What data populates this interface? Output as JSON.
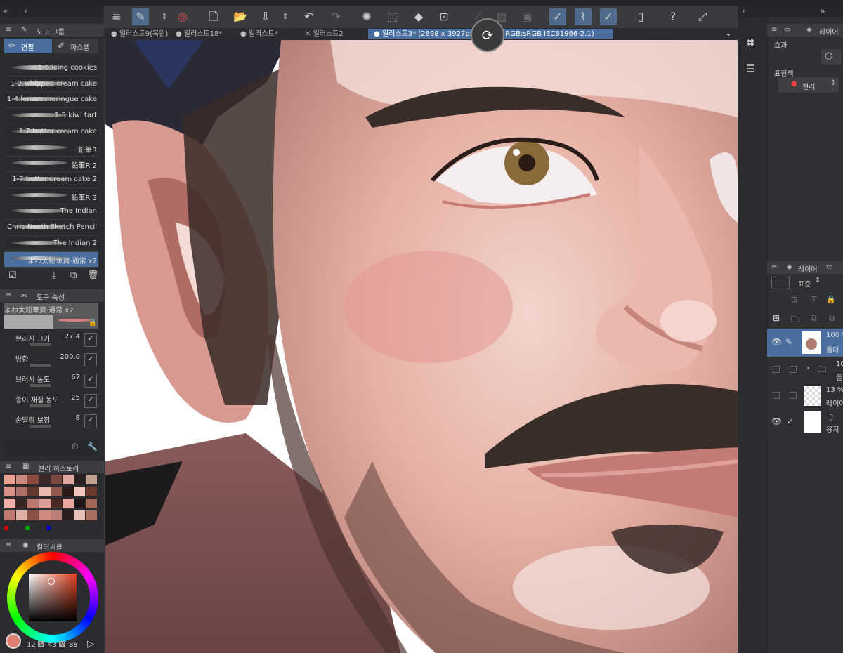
{
  "tool_group": {
    "title": "도구 그룹",
    "tabs": [
      "연필",
      "파스텔"
    ]
  },
  "brushes": [
    "1-6.icing cookies",
    "1-2.whipped cream cake",
    "1-4.lemon meringue cake",
    "1-5.kiwi tart",
    "1-7.butter cream cake",
    "鉛筆R",
    "鉛筆R 2",
    "1-7.butter cream cake 2",
    "鉛筆R 3",
    "The Indian",
    "Chris Noeth Sketch Pencil",
    "The Indian 2",
    "よわ太鉛筆寶·通常 x2"
  ],
  "tool_props": {
    "title": "도구 속성",
    "brush_name": "よわ太鉛筆寶·通常 x2",
    "rows": [
      {
        "label": "브러시 크기",
        "value": "27.4"
      },
      {
        "label": "방향",
        "value": "200.0"
      },
      {
        "label": "브러시 농도",
        "value": "67"
      },
      {
        "label": "종이 재질 농도",
        "value": "25"
      },
      {
        "label": "손떨림 보정",
        "value": "8"
      }
    ]
  },
  "color_history": {
    "title": "컬러 히스토리"
  },
  "color_wheel": {
    "title": "컬러써클",
    "h": "12",
    "s": "43",
    "v": "88",
    "h_label": "H",
    "s_label": "S",
    "v_label": "V"
  },
  "tabs": [
    "일러스트9(복원)",
    "일러스트18*",
    "일러스트*",
    "일러스트2",
    "일러스트3* (2898 x 3927px",
    "6% : RGB:sRGB IEC61966-2.1)"
  ],
  "right": {
    "effect_title": "효과",
    "expression_label": "표현색",
    "expression_value": "컬러",
    "layer_title": "레이어",
    "other_tab": "레이어",
    "blend": "표준",
    "layers": [
      {
        "pct": "100 %",
        "name": "폴더"
      },
      {
        "pct": "100",
        "name": "폴"
      },
      {
        "pct": "13 %",
        "name": "레이어"
      },
      {
        "pct": "",
        "name": "용지"
      }
    ]
  },
  "colors": {
    "history": [
      "#e8a090",
      "#c98a80",
      "#8a4a40",
      "#3a2a28",
      "#7a4a40",
      "#e0a8a0",
      "#2a2020",
      "#c0a090",
      "#d89088",
      "#a87068",
      "#603830",
      "#e8b8b0",
      "#905850",
      "#2a1a18",
      "#f0c8c0",
      "#6a3a30",
      "#f0b0a8",
      "#3a2620",
      "#b87870",
      "#d8a098",
      "#4a2a24",
      "#e8a8a0",
      "#1e1616",
      "#a06858",
      "#c07870",
      "#e0b0a8",
      "#8a5048",
      "#d08880",
      "#ba8078",
      "#2c1e1c",
      "#e8c0b8",
      "#a87060"
    ]
  }
}
